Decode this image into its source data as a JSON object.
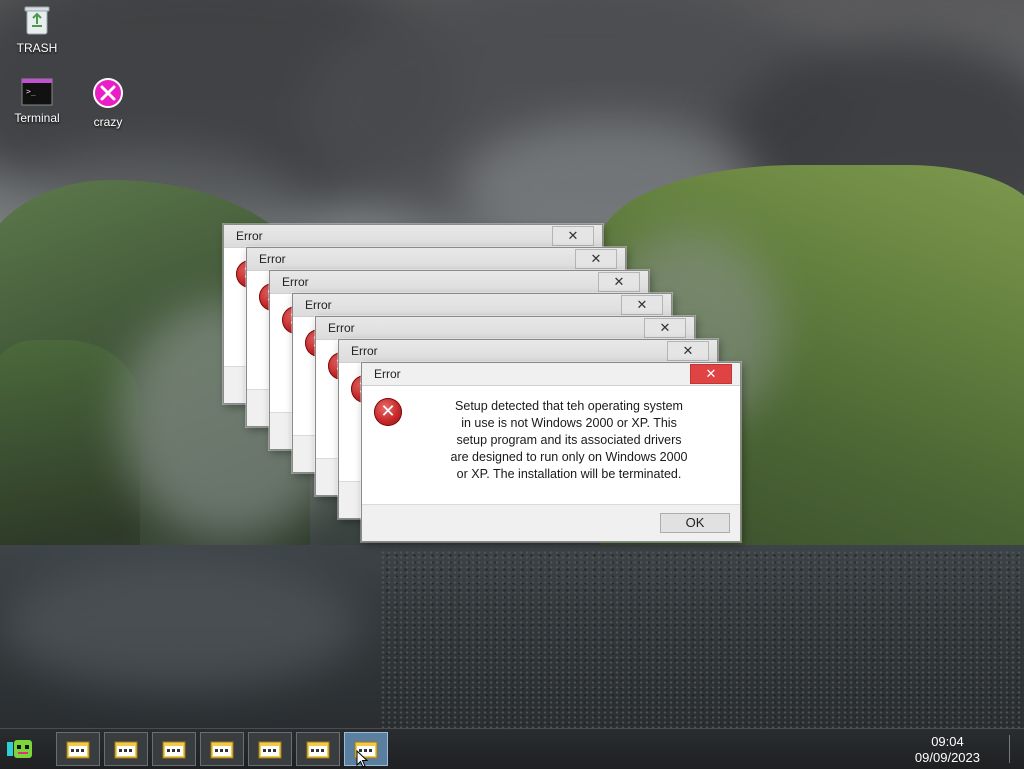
{
  "desktop": {
    "icons": [
      {
        "label": "TRASH",
        "icon": "trash-icon"
      },
      {
        "label": "Terminal",
        "icon": "terminal-icon"
      },
      {
        "label": "crazy",
        "icon": "crazy-icon"
      }
    ]
  },
  "dialogs": {
    "title": "Error",
    "message": "Setup detected that teh operating system\nin use is not Windows 2000 or XP. This\nsetup program and its associated drivers\nare designed to run only on Windows 2000\nor XP. The installation will be terminated.",
    "ok_label": "OK",
    "close_glyph": "✕",
    "count": 7
  },
  "taskbar": {
    "time": "09:04",
    "date": "09/09/2023",
    "window_buttons": [
      "app",
      "app",
      "app",
      "app",
      "app",
      "app",
      "app"
    ],
    "active_index": 6
  },
  "colors": {
    "close_active": "#e04343",
    "error_red": "#c62828",
    "taskbar_active": "#5a7fa0"
  }
}
